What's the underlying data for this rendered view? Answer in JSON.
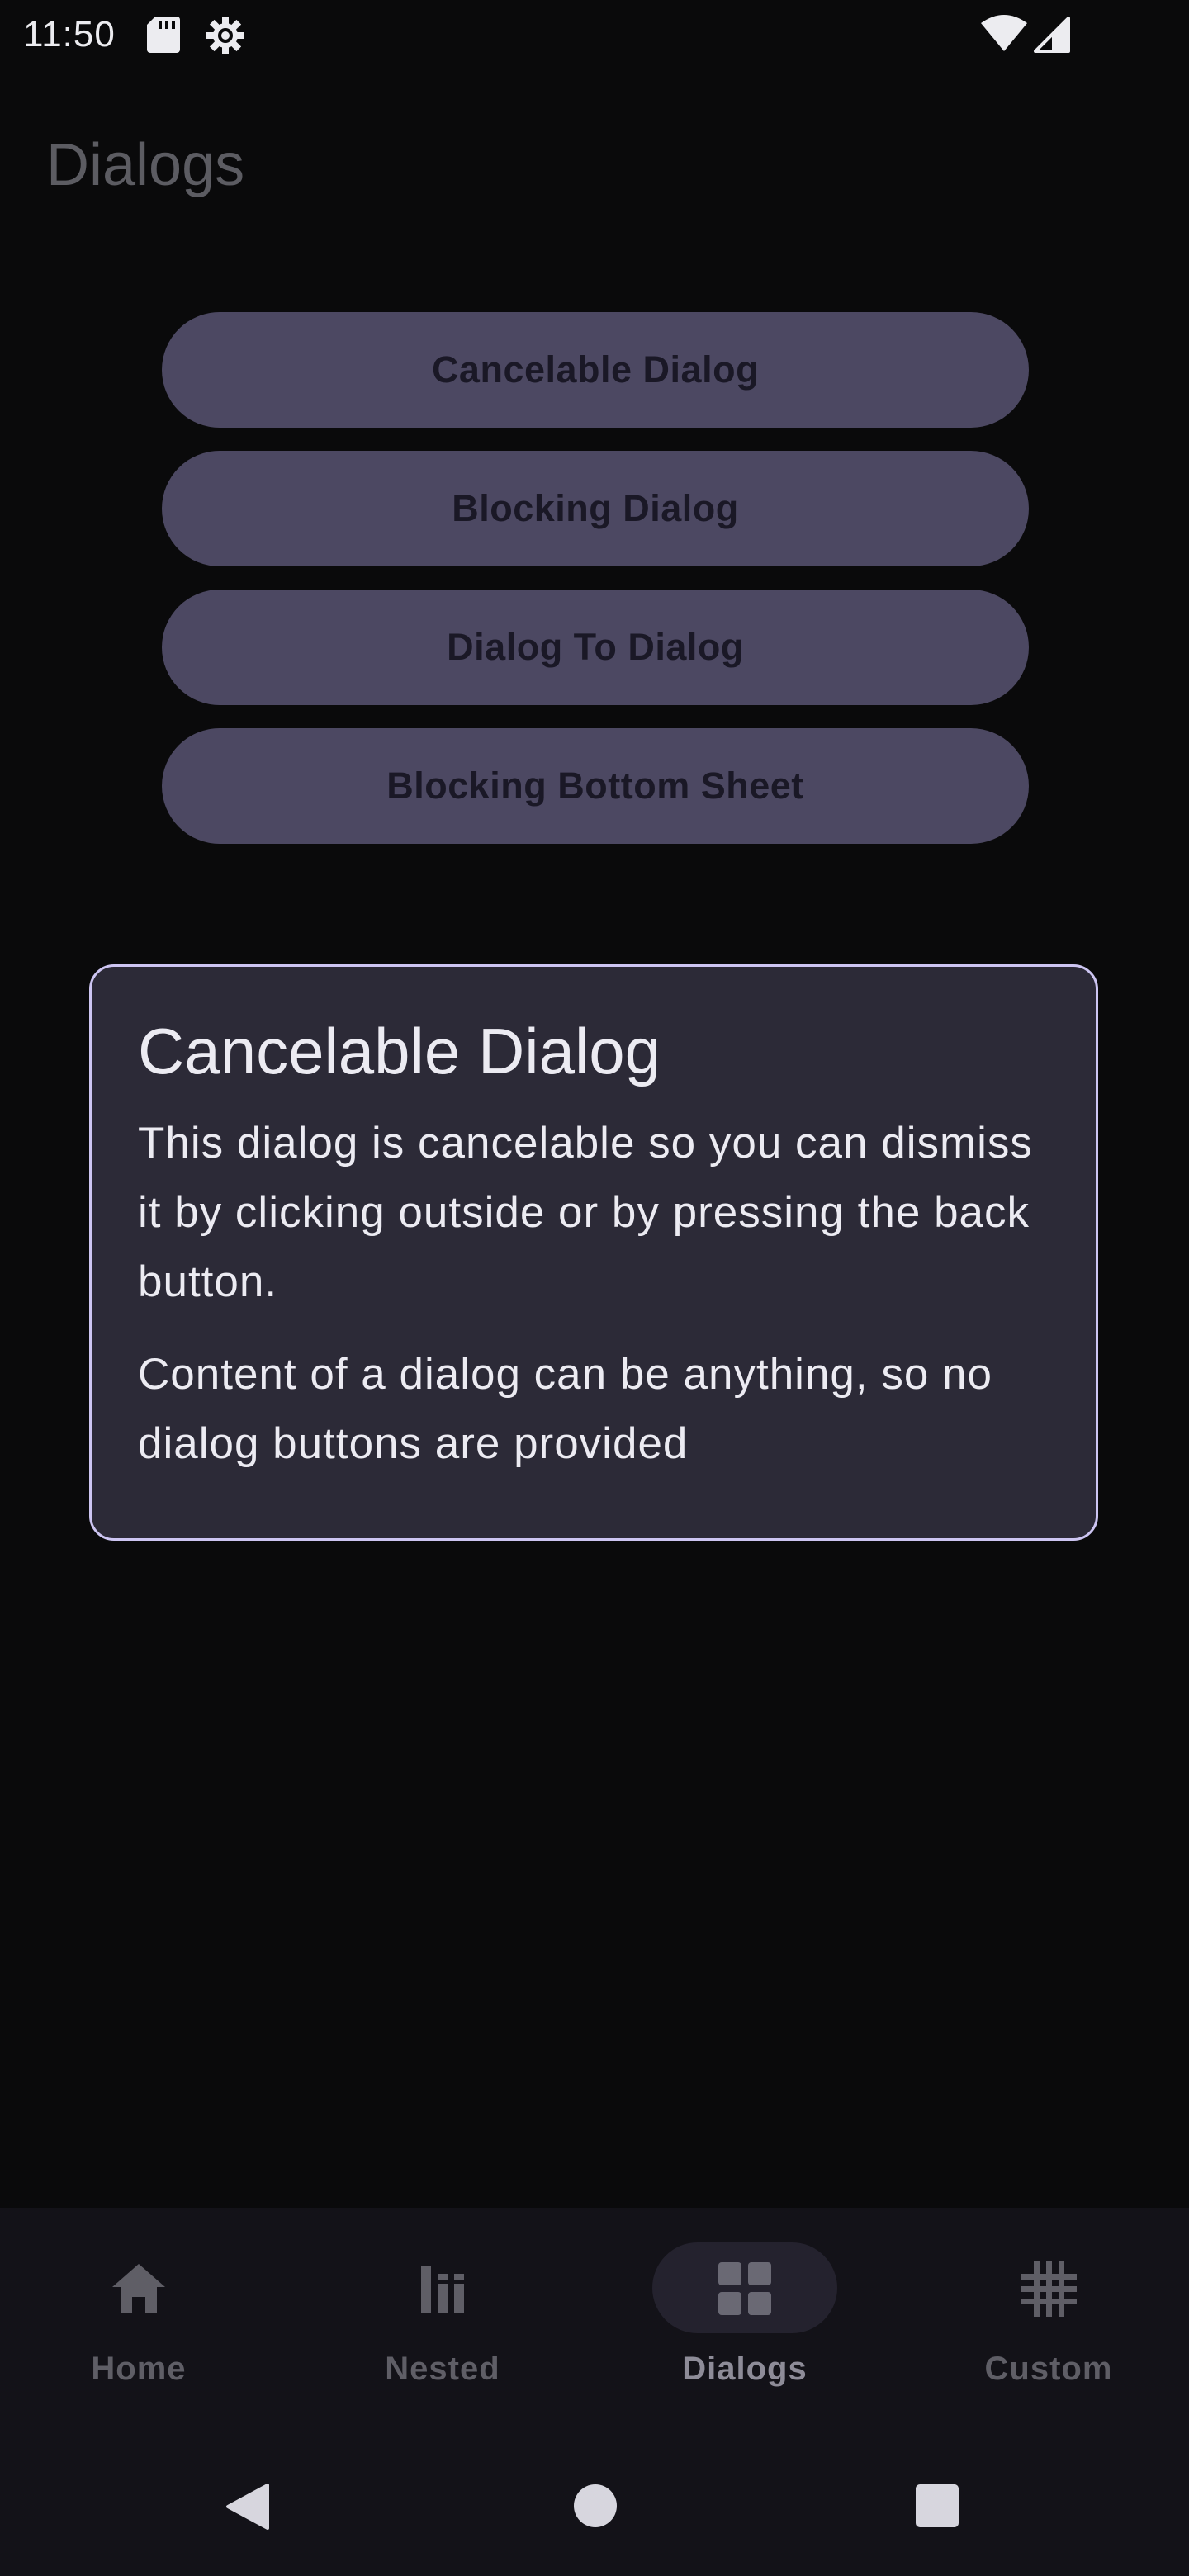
{
  "status_bar": {
    "time": "11:50",
    "icons": [
      "sd-card-icon",
      "gear-icon",
      "wifi-icon",
      "cellular-signal-icon"
    ]
  },
  "header": {
    "title": "Dialogs"
  },
  "buttons": [
    {
      "label": "Cancelable Dialog"
    },
    {
      "label": "Blocking Dialog"
    },
    {
      "label": "Dialog To Dialog"
    },
    {
      "label": "Blocking Bottom Sheet"
    }
  ],
  "dialog": {
    "title": "Cancelable Dialog",
    "paragraphs": [
      "This dialog is cancelable so you can dismiss it by clicking outside or by pressing the back button.",
      "Content of a dialog can be anything, so no dialog buttons are provided"
    ]
  },
  "bottom_nav": {
    "items": [
      {
        "label": "Home",
        "icon": "home-icon",
        "active": false
      },
      {
        "label": "Nested",
        "icon": "bar-chart-icon",
        "active": false
      },
      {
        "label": "Dialogs",
        "icon": "grid-icon",
        "active": true
      },
      {
        "label": "Custom",
        "icon": "hash-grid-icon",
        "active": false
      }
    ]
  },
  "system_nav": {
    "icons": [
      "back-icon",
      "home-circle-icon",
      "recents-icon"
    ]
  },
  "colors": {
    "background": "#0a0a0b",
    "button_fill": "#4c4862",
    "button_text": "#1a1826",
    "dialog_fill": "#2c2a37",
    "dialog_border": "#cdc5f2",
    "nav_background": "#131218"
  }
}
